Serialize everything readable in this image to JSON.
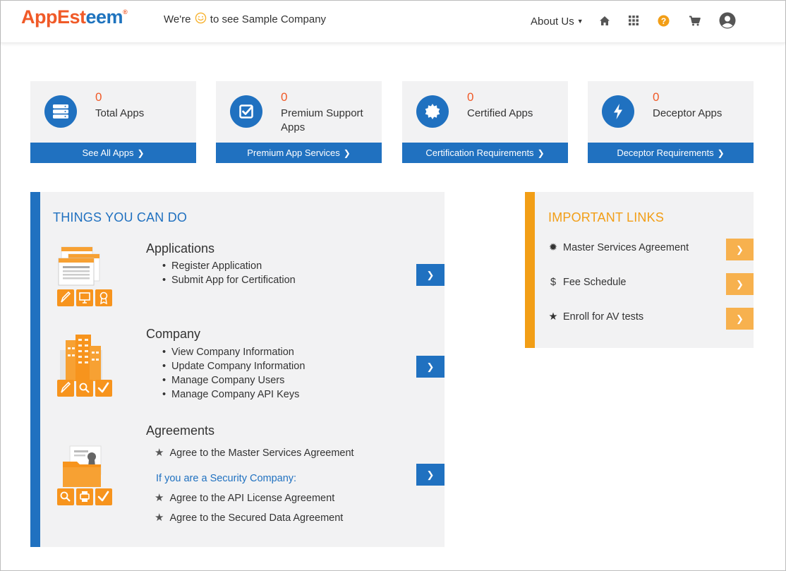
{
  "header": {
    "logo_text": "AppEsteem",
    "logo_reg": "®",
    "welcome_prefix": "We're",
    "welcome_suffix": "to see Sample Company",
    "about_label": "About Us",
    "icons": [
      "home-icon",
      "apps-grid-icon",
      "help-icon",
      "cart-icon",
      "user-avatar-icon"
    ],
    "colors": {
      "logo_blue": "#1e73be",
      "logo_orange": "#f05a28",
      "help_orange": "#f29e16"
    }
  },
  "cards": [
    {
      "count": "0",
      "label": "Total Apps",
      "button": "See All Apps",
      "icon": "server-stack-icon"
    },
    {
      "count": "0",
      "label": "Premium Support Apps",
      "button": "Premium App Services",
      "icon": "checkbox-icon"
    },
    {
      "count": "0",
      "label": "Certified Apps",
      "button": "Certification Requirements",
      "icon": "seal-badge-icon"
    },
    {
      "count": "0",
      "label": "Deceptor Apps",
      "button": "Deceptor Requirements",
      "icon": "lightning-bolt-icon"
    }
  ],
  "things": {
    "title": "THINGS YOU CAN DO",
    "applications": {
      "title": "Applications",
      "items": [
        "Register Application",
        "Submit App for Certification"
      ]
    },
    "company": {
      "title": "Company",
      "items": [
        "View Company Information",
        "Update Company Information",
        "Manage Company Users",
        "Manage Company API Keys"
      ]
    },
    "agreements": {
      "title": "Agreements",
      "item_master": "Agree to the Master Services Agreement",
      "security_heading": "If you are a Security Company:",
      "item_api": "Agree to the API License Agreement",
      "item_secured": "Agree to the Secured Data Agreement"
    }
  },
  "links": {
    "title": "IMPORTANT LINKS",
    "items": [
      {
        "label": "Master Services Agreement",
        "icon": "seal-icon"
      },
      {
        "label": "Fee Schedule",
        "icon": "dollar-icon"
      },
      {
        "label": "Enroll for AV tests",
        "icon": "star-icon"
      }
    ]
  },
  "theme": {
    "primary_blue": "#2071c0",
    "accent_orange": "#f29e16",
    "count_orange": "#f05a28",
    "panel_bg": "#f2f2f3"
  }
}
